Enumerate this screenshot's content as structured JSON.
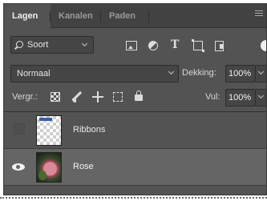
{
  "tabs": [
    {
      "label": "Lagen",
      "active": true
    },
    {
      "label": "Kanalen",
      "active": false
    },
    {
      "label": "Paden",
      "active": false
    }
  ],
  "filter": {
    "kind_label": "Soort",
    "icons": [
      "pixel-layer-filter-icon",
      "adjustment-layer-filter-icon",
      "type-layer-filter-icon",
      "shape-layer-filter-icon",
      "smart-object-filter-icon"
    ]
  },
  "blend": {
    "mode": "Normaal",
    "opacity_label": "Dekking:",
    "opacity_value": "100%"
  },
  "lock": {
    "label": "Vergr.:",
    "icons": [
      "lock-transparent-pixels-icon",
      "lock-image-pixels-icon",
      "lock-position-icon",
      "lock-artboard-icon",
      "lock-all-icon"
    ],
    "fill_label": "Vul:",
    "fill_value": "100%"
  },
  "layers": [
    {
      "name": "Ribbons",
      "visible": false,
      "selected": false
    },
    {
      "name": "Rose",
      "visible": true,
      "selected": true
    }
  ],
  "colors": {
    "panel_bg": "#535353",
    "tab_bar_bg": "#424242",
    "selected_layer_bg": "#656565",
    "field_bg": "#454545"
  }
}
